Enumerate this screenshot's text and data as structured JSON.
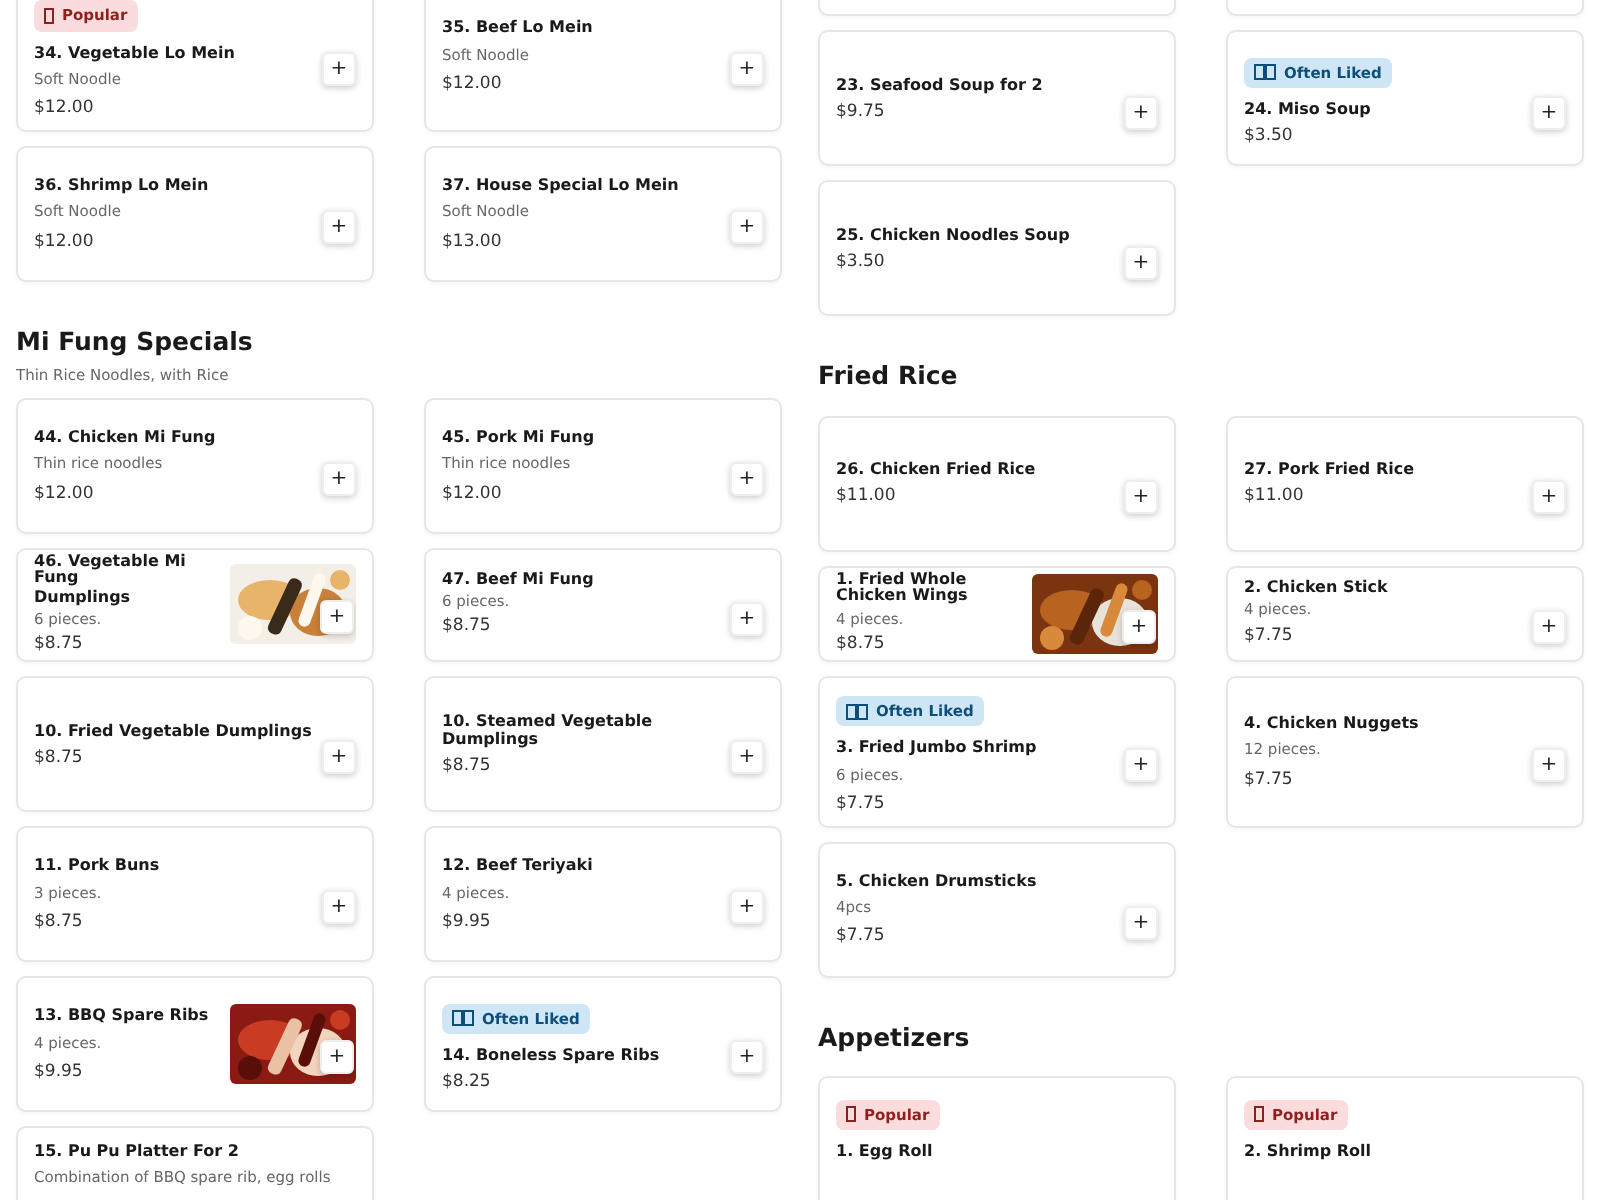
{
  "columns": [
    {
      "sections": [
        {
          "rows": [
            [
              {
                "kind": "item",
                "badge": {
                  "kind": "popular",
                  "label": "Popular"
                },
                "title": "34. Vegetable Lo Mein",
                "description": "Soft Noodle",
                "price": "$12.00",
                "add": "+"
              },
              {
                "kind": "item",
                "title": "35. Beef Lo Mein",
                "description": "Soft Noodle",
                "price": "$12.00",
                "add": "+"
              }
            ],
            [
              {
                "kind": "item",
                "title": "36. Shrimp Lo Mein",
                "description": "Soft Noodle",
                "price": "$12.00",
                "add": "+"
              },
              {
                "kind": "item",
                "title": "37. House Special Lo Mein",
                "description": "Soft Noodle",
                "price": "$13.00",
                "add": "+"
              }
            ]
          ]
        },
        {
          "heading": "Mi Fung Specials",
          "subtitle": "Thin Rice Noodles, with Rice",
          "rows": [
            [
              {
                "kind": "item",
                "title": "44. Chicken Mi Fung",
                "description": "Thin rice noodles",
                "price": "$12.00",
                "add": "+"
              },
              {
                "kind": "item",
                "title": "45. Pork Mi Fung",
                "description": "Thin rice noodles",
                "price": "$12.00",
                "add": "+"
              }
            ],
            [
              {
                "kind": "strip",
                "overlap_title": "46. Vegetable Mi Fung",
                "title": "Dumplings",
                "description": "6 pieces.",
                "price": "$8.75",
                "add": "+"
              },
              {
                "kind": "strip",
                "overlap_title": "47. Beef Mi Fung",
                "description": "6 pieces.",
                "price": "$8.75",
                "add": "+"
              }
            ],
            [
              {
                "kind": "item",
                "title": "10. Fried Vegetable Dumplings",
                "price": "$8.75",
                "add": "+"
              },
              {
                "kind": "item",
                "title": "10. Steamed Vegetable Dumplings",
                "price": "$8.75",
                "add": "+"
              }
            ],
            [
              {
                "kind": "item",
                "title": "11. Pork Buns",
                "description": "3 pieces.",
                "price": "$8.75",
                "add": "+"
              },
              {
                "kind": "item",
                "title": "12. Beef Teriyaki",
                "description": "4 pieces.",
                "price": "$9.95",
                "add": "+"
              }
            ],
            [
              {
                "kind": "item",
                "title": "13. BBQ Spare Ribs",
                "description": "4 pieces.",
                "price": "$9.95",
                "add": "+"
              },
              {
                "kind": "item",
                "badge": {
                  "kind": "liked",
                  "label": "Often Liked"
                },
                "title": "14. Boneless Spare Ribs",
                "price": "$8.25",
                "add": "+"
              }
            ],
            [
              {
                "kind": "item",
                "title": "15. Pu Pu Platter For 2",
                "description": "Combination of BBQ spare rib, egg rolls"
              }
            ]
          ]
        }
      ]
    },
    {
      "sections": [
        {
          "rows": [
            [
              {
                "kind": "stub"
              },
              {
                "kind": "stub"
              }
            ],
            [
              {
                "kind": "item",
                "title": "23. Seafood Soup for 2",
                "price": "$9.75",
                "add": "+"
              },
              {
                "kind": "item",
                "badge": {
                  "kind": "liked",
                  "label": "Often Liked"
                },
                "title": "24. Miso Soup",
                "price": "$3.50",
                "add": "+"
              }
            ],
            [
              {
                "kind": "item",
                "title": "25. Chicken Noodles Soup",
                "price": "$3.50",
                "add": "+"
              }
            ]
          ]
        },
        {
          "heading": "Fried Rice",
          "rows": [
            [
              {
                "kind": "item",
                "title": "26. Chicken Fried Rice",
                "price": "$11.00",
                "add": "+"
              },
              {
                "kind": "item",
                "title": "27. Pork Fried Rice",
                "price": "$11.00",
                "add": "+"
              }
            ],
            [
              {
                "kind": "strip",
                "title": "1. Fried Whole Chicken Wings",
                "description": "4 pieces.",
                "price": "$8.75",
                "add": "+"
              },
              {
                "kind": "strip",
                "title": "2. Chicken Stick",
                "description": "4 pieces.",
                "price": "$7.75",
                "add": "+"
              }
            ],
            [
              {
                "kind": "item",
                "badge": {
                  "kind": "liked",
                  "label": "Often Liked"
                },
                "title": "3. Fried Jumbo Shrimp",
                "description": "6 pieces.",
                "price": "$7.75",
                "add": "+"
              },
              {
                "kind": "item",
                "title": "4. Chicken Nuggets",
                "description": "12 pieces.",
                "price": "$7.75",
                "add": "+"
              }
            ],
            [
              {
                "kind": "item",
                "title": "5. Chicken Drumsticks",
                "description": "4pcs",
                "price": "$7.75",
                "add": "+"
              }
            ]
          ]
        },
        {
          "heading": "Appetizers",
          "rows": [
            [
              {
                "kind": "item",
                "badge": {
                  "kind": "popular",
                  "label": "Popular"
                },
                "title": "1. Egg Roll"
              },
              {
                "kind": "item",
                "badge": {
                  "kind": "popular",
                  "label": "Popular"
                },
                "title": "2. Shrimp Roll"
              }
            ]
          ]
        }
      ]
    }
  ]
}
